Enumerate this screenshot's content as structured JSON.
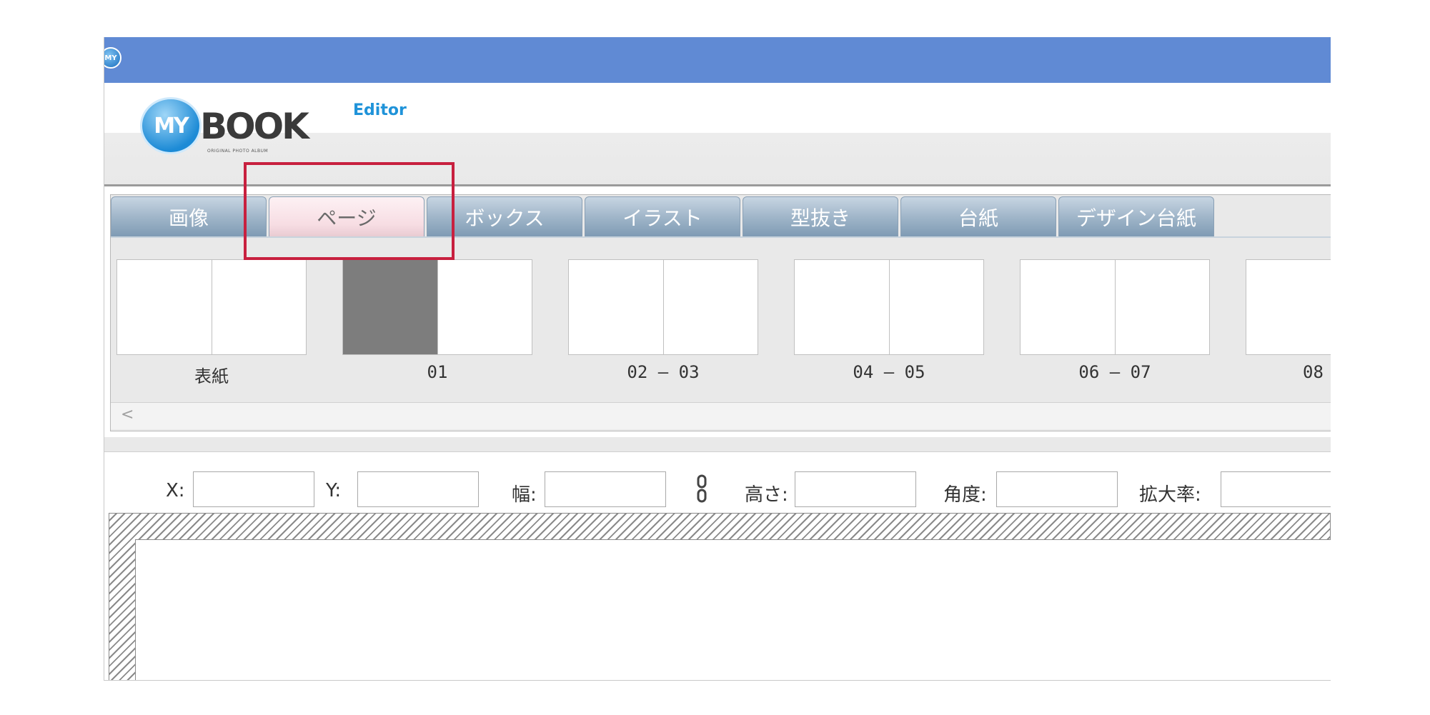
{
  "window": {
    "app_icon_text": "MY"
  },
  "logo": {
    "my": "MY",
    "book": "BOOK",
    "editor": "Editor",
    "sub": "ORIGINAL PHOTO ALBUM"
  },
  "tabs": [
    {
      "label": "画像",
      "active": false
    },
    {
      "label": "ページ",
      "active": true
    },
    {
      "label": "ボックス",
      "active": false
    },
    {
      "label": "イラスト",
      "active": false
    },
    {
      "label": "型抜き",
      "active": false
    },
    {
      "label": "台紙",
      "active": false
    },
    {
      "label": "デザイン台紙",
      "active": false
    }
  ],
  "pages": [
    {
      "label": "表紙",
      "dark_left": false
    },
    {
      "label": "01",
      "dark_left": true
    },
    {
      "label": "02 – 03",
      "dark_left": false
    },
    {
      "label": "04 – 05",
      "dark_left": false
    },
    {
      "label": "06 – 07",
      "dark_left": false
    },
    {
      "label": "08",
      "dark_left": false
    }
  ],
  "scroll": {
    "left_arrow": "<"
  },
  "properties": {
    "x_label": "X:",
    "y_label": "Y:",
    "width_label": "幅:",
    "height_label": "高さ:",
    "angle_label": "角度:",
    "scale_label": "拡大率:",
    "x_value": "",
    "y_value": "",
    "width_value": "",
    "height_value": "",
    "angle_value": "",
    "scale_value": ""
  },
  "colors": {
    "titlebar": "#608ad4",
    "highlight": "#c8203f",
    "tab_inactive": "#9db3c7",
    "tab_active": "#f7dde3"
  },
  "icons": {
    "app": "app-logo-icon",
    "chain": "chain-link-icon"
  }
}
